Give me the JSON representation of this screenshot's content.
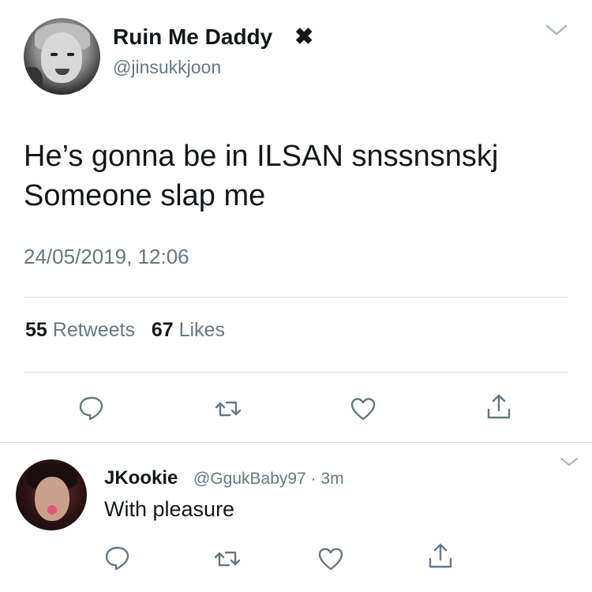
{
  "tweet": {
    "author_name": "Ruin Me Daddy",
    "author_name_suffix": "✖",
    "author_handle": "@jinsukkjoon",
    "text": "He’s gonna be in ILSAN snssnsnskj\nSomeone slap me",
    "timestamp": "24/05/2019, 12:06",
    "retweets_count": "55",
    "retweets_label": "Retweets",
    "likes_count": "67",
    "likes_label": "Likes"
  },
  "reply": {
    "author_name": "JKookie",
    "author_handle": "@GgukBaby97",
    "separator": "·",
    "time": "3m",
    "text": "With pleasure"
  },
  "icons": {
    "reply": "reply-icon",
    "retweet": "retweet-icon",
    "like": "heart-icon",
    "share": "share-icon",
    "menu": "chevron-down-icon"
  },
  "colors": {
    "text": "#14171a",
    "secondary": "#657786",
    "divider": "#d9dee3"
  }
}
